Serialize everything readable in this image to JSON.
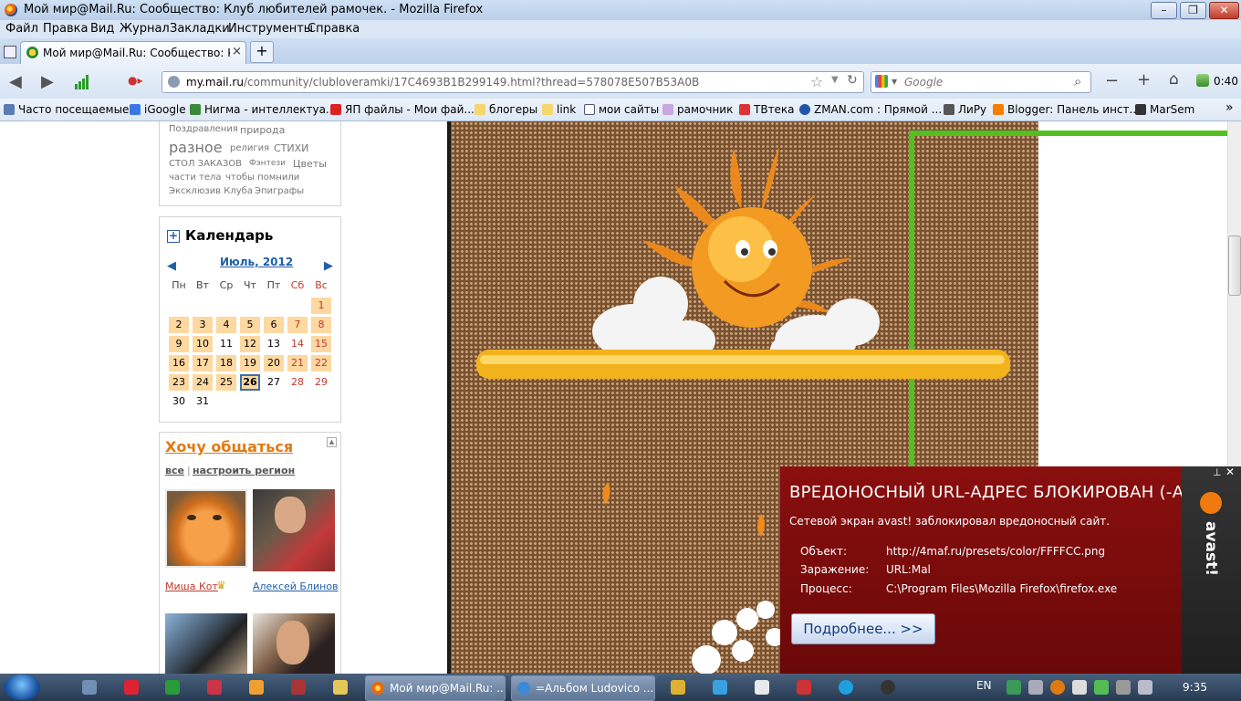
{
  "window": {
    "title": "Мой мир@Mail.Ru: Сообщество: Клуб любителей рамочек. - Mozilla Firefox"
  },
  "menu": [
    "Файл",
    "Правка",
    "Вид",
    "Журнал",
    "Закладки",
    "Инструменты",
    "Справка"
  ],
  "tab": {
    "label": "Мой мир@Mail.Ru: Сообщество: К...",
    "close": "×",
    "new": "+"
  },
  "nav": {
    "url_host": "my.mail.ru",
    "url_path": "/community/clubloveramki/17C4693B1B299149.html?thread=578078E507B53A0B",
    "search_placeholder": "Google",
    "time": "0:40"
  },
  "bookmarks": [
    "Часто посещаемые",
    "iGoogle",
    "Нигма - интеллектуа...",
    "ЯП файлы - Мои фай...",
    "блогеры",
    "link",
    "мои сайты",
    "рамочник",
    "ТВтека",
    "ZMAN.com : Прямой ...",
    "ЛиРу",
    "Blogger: Панель инст...",
    "MarSem"
  ],
  "tags": {
    "row1": [
      "Поздравления",
      "природа"
    ],
    "row2": [
      "разное",
      "религия",
      "СТИХИ"
    ],
    "row3": [
      "СТОЛ ЗАКАЗОВ",
      "Фэнтези",
      "Цветы"
    ],
    "row4": [
      "части тела",
      "чтобы помнили"
    ],
    "row5": [
      "Эксклюзив Клуба",
      "Эпиграфы"
    ]
  },
  "calendar": {
    "title": "Календарь",
    "month": "Июль, 2012",
    "days": [
      "Пн",
      "Вт",
      "Ср",
      "Чт",
      "Пт",
      "Сб",
      "Вс"
    ],
    "weeks": [
      [
        "",
        "",
        "",
        "",
        "",
        "",
        "1"
      ],
      [
        "2",
        "3",
        "4",
        "5",
        "6",
        "7",
        "8"
      ],
      [
        "9",
        "10",
        "11",
        "12",
        "13",
        "14",
        "15"
      ],
      [
        "16",
        "17",
        "18",
        "19",
        "20",
        "21",
        "22"
      ],
      [
        "23",
        "24",
        "25",
        "26",
        "27",
        "28",
        "29"
      ],
      [
        "30",
        "31",
        "",
        "",
        "",
        "",
        ""
      ]
    ],
    "highlighted": [
      "1",
      "2",
      "3",
      "4",
      "5",
      "6",
      "7",
      "8",
      "9",
      "10",
      "12",
      "15",
      "16",
      "17",
      "18",
      "19",
      "20",
      "21",
      "22",
      "23",
      "24",
      "25",
      "26"
    ],
    "today": "26"
  },
  "social": {
    "title": "Хочу общаться",
    "filter_all": "все",
    "filter_sep": "|",
    "filter_region": "настроить регион",
    "people": [
      {
        "name": "Миша Кот"
      },
      {
        "name": "Алексей Блинов"
      }
    ]
  },
  "avast": {
    "title": "ВРЕДОНОСНЫЙ URL-АДРЕС БЛОКИРОВАН (-A)",
    "subtitle": "Сетевой экран avast! заблокировал вредоносный сайт.",
    "object_label": "Объект:",
    "object_value": "http://4maf.ru/presets/color/FFFFCC.png",
    "infection_label": "Заражение:",
    "infection_value": "URL:Mal",
    "process_label": "Процесс:",
    "process_value": "C:\\Program Files\\Mozilla Firefox\\firefox.exe",
    "button": "Подробнее... >>",
    "brand": "avast!"
  },
  "taskbar": {
    "task1": "Мой мир@Mail.Ru: ...",
    "task2": "=Альбом Ludovico ...",
    "lang": "EN",
    "clock": "9:35"
  }
}
